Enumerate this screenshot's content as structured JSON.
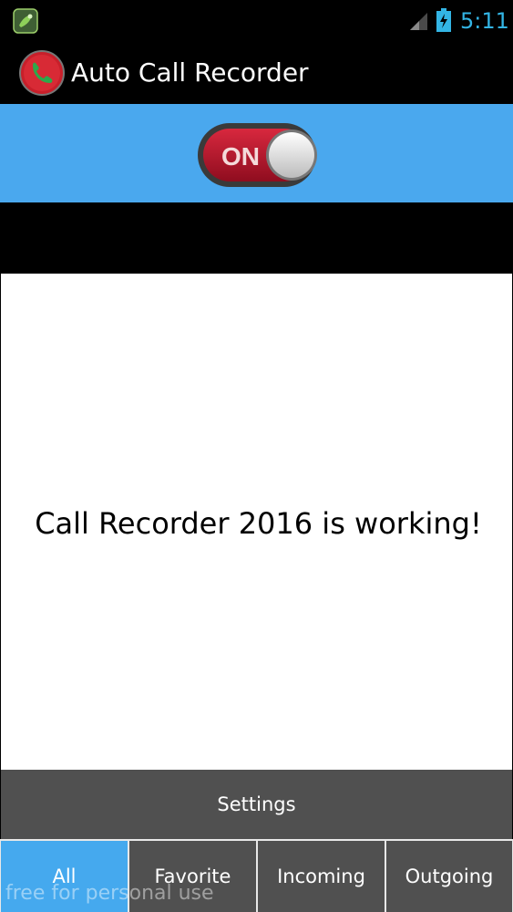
{
  "status_bar": {
    "time": "5:11",
    "app_icon": "app-notification-icon",
    "signal_icon": "signal-icon",
    "battery_icon": "battery-charging-icon",
    "accent_color": "#33b5e5"
  },
  "action_bar": {
    "title": "Auto Call Recorder",
    "logo_icon": "phone-record-icon"
  },
  "toggle": {
    "label": "ON",
    "state": "on",
    "band_color": "#4aa8ee",
    "switch_color": "#b8152e"
  },
  "main": {
    "message": "Call Recorder 2016 is working!"
  },
  "settings": {
    "label": "Settings"
  },
  "tabs": [
    {
      "label": "All",
      "active": true
    },
    {
      "label": "Favorite",
      "active": false
    },
    {
      "label": "Incoming",
      "active": false
    },
    {
      "label": "Outgoing",
      "active": false
    }
  ],
  "watermark": "free for personal use"
}
